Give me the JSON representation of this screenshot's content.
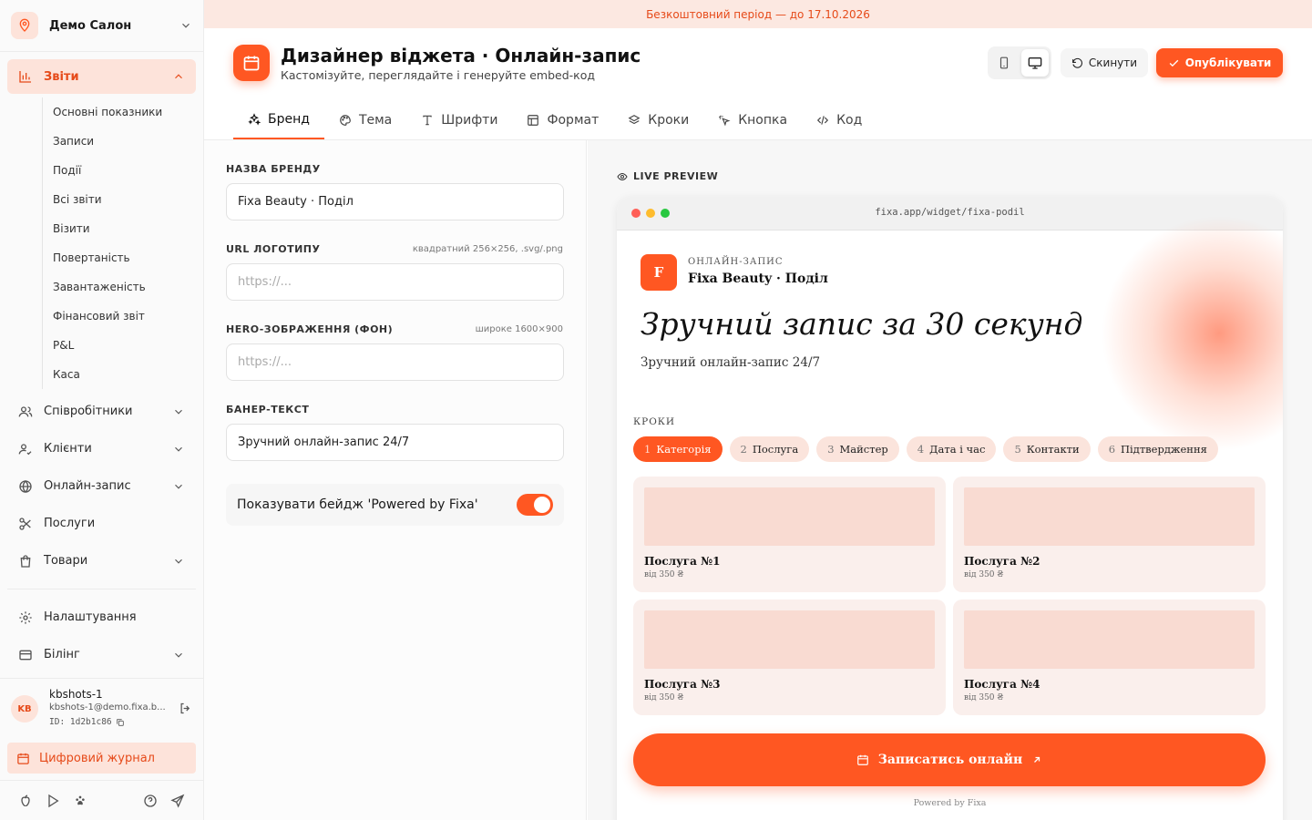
{
  "colors": {
    "accent": "#ff5722",
    "accent_soft": "#fde3da",
    "banner_bg": "#fce8e1"
  },
  "sidebar": {
    "salon_name": "Демо Салон",
    "reports": {
      "label": "Звіти",
      "items": [
        "Основні показники",
        "Записи",
        "Події",
        "Всі звіти",
        "Візити",
        "Повертаність",
        "Завантаженість",
        "Фінансовий звіт",
        "P&L",
        "Каса"
      ]
    },
    "nav": [
      {
        "label": "Співробітники",
        "icon": "users-icon"
      },
      {
        "label": "Клієнти",
        "icon": "user-check-icon"
      },
      {
        "label": "Онлайн-запис",
        "icon": "globe-icon"
      },
      {
        "label": "Послуги",
        "icon": "scissors-icon"
      },
      {
        "label": "Товари",
        "icon": "shopping-bag-icon"
      }
    ],
    "settings_label": "Налаштування",
    "billing_label": "Білінг",
    "user": {
      "initials": "KB",
      "name": "kbshots-1",
      "email": "kbshots-1@demo.fixa.b...",
      "id": "ID: 1d2b1c86"
    },
    "journal_label": "Цифровий журнал"
  },
  "trial_banner": "Безкоштовний період — до 17.10.2026",
  "header": {
    "title": "Дизайнер віджета · Онлайн-запис",
    "subtitle": "Кастомізуйте, переглядайте і генеруйте embed-код",
    "reset_label": "Скинути",
    "publish_label": "Опублікувати",
    "tabs": [
      "Бренд",
      "Тема",
      "Шрифти",
      "Формат",
      "Кроки",
      "Кнопка",
      "Код"
    ]
  },
  "form": {
    "brand_name": {
      "label": "НАЗВА БРЕНДУ",
      "value": "Fixa Beauty · Поділ"
    },
    "logo_url": {
      "label": "URL ЛОГОТИПУ",
      "hint": "квадратний 256×256, .svg/.png",
      "placeholder": "https://..."
    },
    "hero_image": {
      "label": "HERO-ЗОБРАЖЕННЯ (ФОН)",
      "hint": "широке 1600×900",
      "placeholder": "https://..."
    },
    "banner_text": {
      "label": "БАНЕР-ТЕКСТ",
      "value": "Зручний онлайн-запис 24/7"
    },
    "badge_toggle": {
      "label": "Показувати бейдж 'Powered by Fixa'",
      "on": true
    }
  },
  "preview": {
    "label": "LIVE PREVIEW",
    "url": "fixa.app/widget/fixa-podil",
    "logo_letter": "F",
    "kicker": "ОНЛАЙН-ЗАПИС",
    "brand": "Fixa Beauty · Поділ",
    "hero": "Зручний запис за 30 секунд",
    "banner": "Зручний онлайн-запис 24/7",
    "steps_title": "КРОКИ",
    "steps": [
      {
        "n": "1",
        "label": "Категорія"
      },
      {
        "n": "2",
        "label": "Послуга"
      },
      {
        "n": "3",
        "label": "Майстер"
      },
      {
        "n": "4",
        "label": "Дата і час"
      },
      {
        "n": "5",
        "label": "Контакти"
      },
      {
        "n": "6",
        "label": "Підтвердження"
      }
    ],
    "services": [
      {
        "title": "Послуга №1",
        "price": "від 350 ₴"
      },
      {
        "title": "Послуга №2",
        "price": "від 350 ₴"
      },
      {
        "title": "Послуга №3",
        "price": "від 350 ₴"
      },
      {
        "title": "Послуга №4",
        "price": "від 350 ₴"
      }
    ],
    "cta": "Записатись онлайн",
    "powered": "Powered by Fixa"
  }
}
